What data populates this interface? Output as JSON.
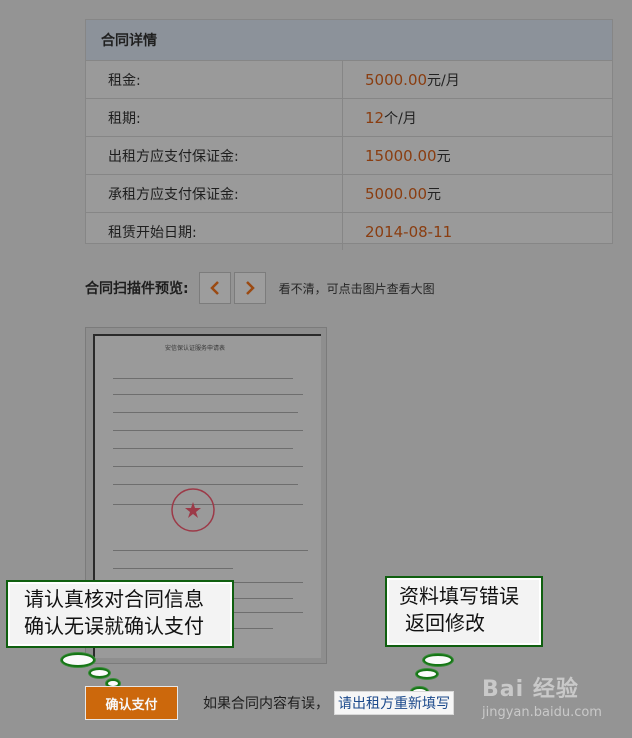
{
  "contract": {
    "title": "合同详情",
    "rows": [
      {
        "label": "租金:",
        "value": "5000.00",
        "unit": "元/月"
      },
      {
        "label": "租期:",
        "value": "12",
        "unit": "个/月"
      },
      {
        "label": "出租方应支付保证金:",
        "value": "15000.00",
        "unit": "元"
      },
      {
        "label": "承租方应支付保证金:",
        "value": "5000.00",
        "unit": "元"
      },
      {
        "label": "租赁开始日期:",
        "value": "2014-08-11",
        "unit": ""
      }
    ]
  },
  "preview": {
    "title": "合同扫描件预览:",
    "prev_icon": "chevron-left-icon",
    "next_icon": "chevron-right-icon",
    "hint": "看不清，可点击图片查看大图",
    "doc_title": "安信保认证服务申请表"
  },
  "annotations": {
    "left": {
      "line1": "请认真核对合同信息",
      "line2": "确认无误就确认支付"
    },
    "right": {
      "line1": "资料填写错误",
      "line2": "返回修改"
    }
  },
  "actions": {
    "confirm_label": "确认支付",
    "note": "如果合同内容有误，",
    "refill_link": "请出租方重新填写"
  },
  "watermark": {
    "logo": "Bai 经验",
    "url": "jingyan.baidu.com"
  },
  "colors": {
    "accent": "#cc680c",
    "value_text": "#8a3d10",
    "callout_border": "#0f5f0f",
    "link": "#1c4a8c"
  }
}
